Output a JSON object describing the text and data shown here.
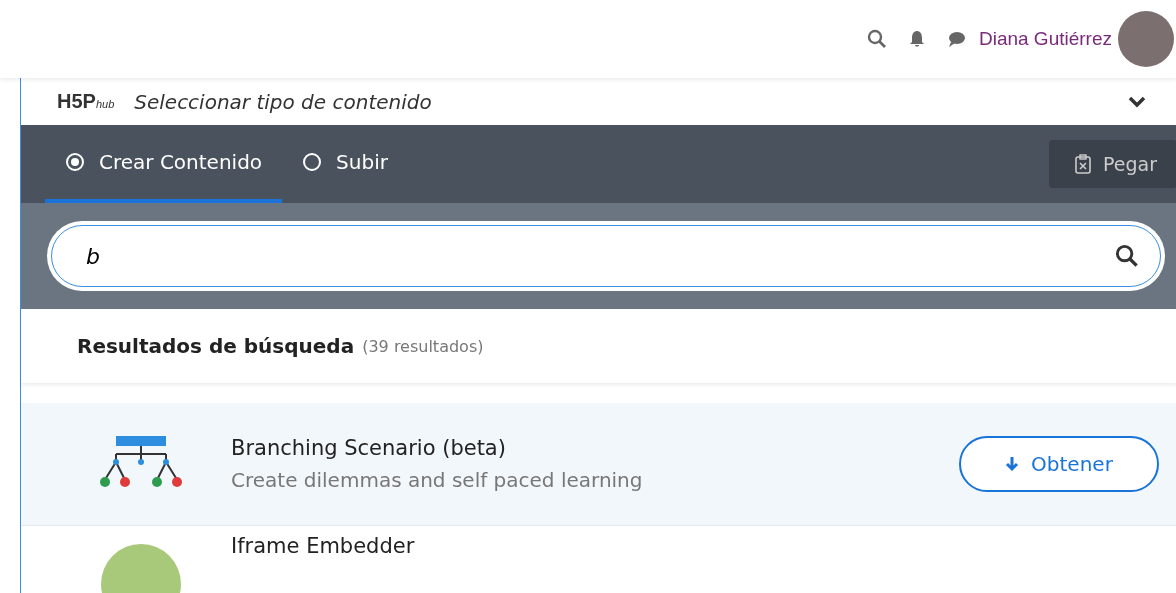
{
  "top_bar": {
    "user_name": "Diana Gutiérrez"
  },
  "hub_header": {
    "logo": "H5P",
    "logo_suffix": "hub",
    "title": "Seleccionar tipo de contenido",
    "expanded": true
  },
  "tabs": [
    {
      "label": "Crear Contenido",
      "selected": true
    },
    {
      "label": "Subir",
      "selected": false
    }
  ],
  "paste_button": "Pegar",
  "search": {
    "value": "b"
  },
  "results": {
    "heading": "Resultados de búsqueda",
    "count": "(39 resultados)"
  },
  "items": [
    {
      "title": "Branching Scenario (beta)",
      "description": "Create dilemmas and self paced learning",
      "button": "Obtener",
      "kind": "branching",
      "selected": true
    },
    {
      "title": "Iframe Embedder",
      "kind": "circle",
      "selected": false
    }
  ]
}
